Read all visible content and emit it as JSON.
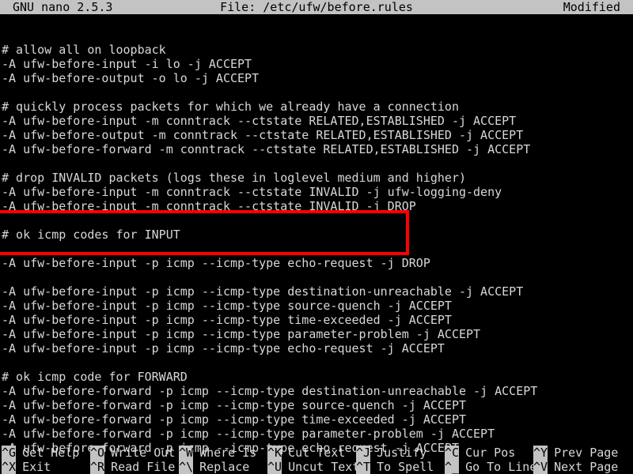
{
  "titlebar": {
    "version": "GNU nano 2.5.3",
    "file_label": "File: /etc/ufw/before.rules",
    "modified_flag": "Modified"
  },
  "editor": {
    "lines": [
      "# allow all on loopback",
      "-A ufw-before-input -i lo -j ACCEPT",
      "-A ufw-before-output -o lo -j ACCEPT",
      "",
      "# quickly process packets for which we already have a connection",
      "-A ufw-before-input -m conntrack --ctstate RELATED,ESTABLISHED -j ACCEPT",
      "-A ufw-before-output -m conntrack --ctstate RELATED,ESTABLISHED -j ACCEPT",
      "-A ufw-before-forward -m conntrack --ctstate RELATED,ESTABLISHED -j ACCEPT",
      "",
      "# drop INVALID packets (logs these in loglevel medium and higher)",
      "-A ufw-before-input -m conntrack --ctstate INVALID -j ufw-logging-deny",
      "-A ufw-before-input -m conntrack --ctstate INVALID -j DROP",
      "",
      "# ok icmp codes for INPUT",
      "",
      "-A ufw-before-input -p icmp --icmp-type echo-request -j DROP",
      "",
      "-A ufw-before-input -p icmp --icmp-type destination-unreachable -j ACCEPT",
      "-A ufw-before-input -p icmp --icmp-type source-quench -j ACCEPT",
      "-A ufw-before-input -p icmp --icmp-type time-exceeded -j ACCEPT",
      "-A ufw-before-input -p icmp --icmp-type parameter-problem -j ACCEPT",
      "-A ufw-before-input -p icmp --icmp-type echo-request -j ACCEPT",
      "",
      "# ok icmp code for FORWARD",
      "-A ufw-before-forward -p icmp --icmp-type destination-unreachable -j ACCEPT",
      "-A ufw-before-forward -p icmp --icmp-type source-quench -j ACCEPT",
      "-A ufw-before-forward -p icmp --icmp-type time-exceeded -j ACCEPT",
      "-A ufw-before-forward -p icmp --icmp-type parameter-problem -j ACCEPT",
      "-A ufw-before-forward -p icmp --icmp-type echo-request -j ACCEPT"
    ]
  },
  "annotation": {
    "color": "#ff0000",
    "highlighted_lines": [
      "# ok icmp codes for INPUT",
      "",
      "-A ufw-before-input -p icmp --icmp-type echo-request -j DROP"
    ]
  },
  "helpbar": {
    "row1": [
      {
        "key": "^G",
        "label": "Get Help"
      },
      {
        "key": "^O",
        "label": "Write Out"
      },
      {
        "key": "^W",
        "label": "Where Is"
      },
      {
        "key": "^K",
        "label": "Cut Text"
      },
      {
        "key": "^J",
        "label": "Justify"
      },
      {
        "key": "^C",
        "label": "Cur Pos"
      },
      {
        "key": "^Y",
        "label": "Prev Page"
      }
    ],
    "row2": [
      {
        "key": "^X",
        "label": "Exit"
      },
      {
        "key": "^R",
        "label": "Read File"
      },
      {
        "key": "^\\",
        "label": "Replace"
      },
      {
        "key": "^U",
        "label": "Uncut Text"
      },
      {
        "key": "^T",
        "label": "To Spell"
      },
      {
        "key": "^_",
        "label": "Go To Line"
      },
      {
        "key": "^V",
        "label": "Next Page"
      }
    ]
  },
  "theme": {
    "background": "#000000",
    "foreground": "#d8d8d8",
    "inverse_background": "#c3c3c3",
    "inverse_foreground": "#000000",
    "annotation_red": "#ff0000"
  }
}
